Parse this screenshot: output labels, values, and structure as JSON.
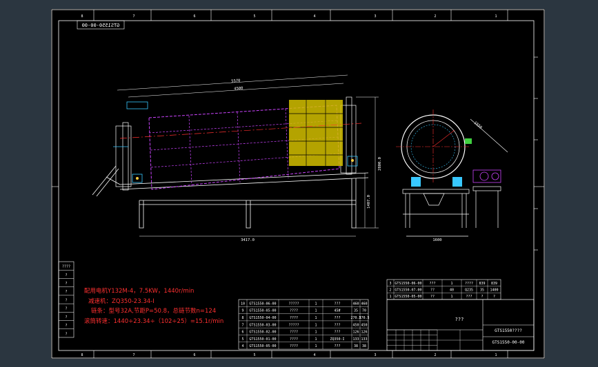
{
  "drawing_number_top": "GTS1550-00-00",
  "drawing_number_bottom": "GTS1550-00-00",
  "title_small": "GTS1550????",
  "title_center": "???",
  "notes": [
    "配用电机Y132M-4，7.5KW，1440r/min",
    "减速机：ZQ350-23.34-I",
    "链条：型号32A,节距P=50.8，总链节数n=124",
    "滚筒转速：1440÷23.34÷（102÷25）=15.1r/min"
  ],
  "dimensions": {
    "overall_length": "5570",
    "drum_length": "4500",
    "frame_length": "3417.0",
    "height_total": "2800.0",
    "height_lower": "1407.0",
    "end_view_width": "1600",
    "drum_diameter": "1550"
  },
  "border_numbers_top": [
    "8",
    "7",
    "6",
    "5",
    "4",
    "3",
    "2",
    "1"
  ],
  "border_numbers_bottom": [
    "8",
    "7",
    "6",
    "5",
    "4",
    "3",
    "2",
    "1"
  ],
  "left_revision_rows": [
    "????",
    "?",
    "?",
    "?",
    "?",
    "?",
    "?",
    "?",
    "?"
  ],
  "parts_list": [
    {
      "no": "10",
      "code": "GTS1550-06-00",
      "name": "?????",
      "qty": "1",
      "mat": "???",
      "w1": "460",
      "w2": "460"
    },
    {
      "no": "9",
      "code": "GTS1550-05-00",
      "name": "????",
      "qty": "1",
      "mat": "45#",
      "w1": "35",
      "w2": "70"
    },
    {
      "no": "8",
      "code": "GTS1550-04-00",
      "name": "????",
      "qty": "1",
      "mat": "???",
      "w1": "270.5",
      "w2": "270.5"
    },
    {
      "no": "7",
      "code": "GTS1550-03-00",
      "name": "?????",
      "qty": "1",
      "mat": "???",
      "w1": "450",
      "w2": "450"
    },
    {
      "no": "6",
      "code": "GTS1550-02-00",
      "name": "????",
      "qty": "1",
      "mat": "???",
      "w1": "126",
      "w2": "126"
    },
    {
      "no": "5",
      "code": "GTS1550-01-00",
      "name": "????",
      "qty": "1",
      "mat": "ZQ350-I",
      "w1": "133",
      "w2": "133"
    },
    {
      "no": "4",
      "code": "GTS1550-05-00",
      "name": "????",
      "qty": "1",
      "mat": "???",
      "w1": "38",
      "w2": "38"
    }
  ],
  "parts_list_upper": [
    {
      "no": "3",
      "code": "GTS1550-06-00",
      "name": "???",
      "qty": "1",
      "mat": "????",
      "w1": "839",
      "w2": "839"
    },
    {
      "no": "2",
      "code": "GTS1550-07-00",
      "name": "??",
      "qty": "40",
      "mat": "Q235",
      "w1": "35",
      "w2": "1400"
    },
    {
      "no": "1",
      "code": "GTS1550-05-00",
      "name": "??",
      "qty": "1",
      "mat": "???",
      "w1": "?",
      "w2": "?"
    }
  ],
  "colors": {
    "sheet_bg": "#000000",
    "line": "#ffffff",
    "drum": "#cc44ff",
    "screen_mesh": "#d4c000",
    "centerline": "#ff3030",
    "cyan": "#38c8ff",
    "green": "#40d040",
    "note_text": "#ff3030"
  }
}
